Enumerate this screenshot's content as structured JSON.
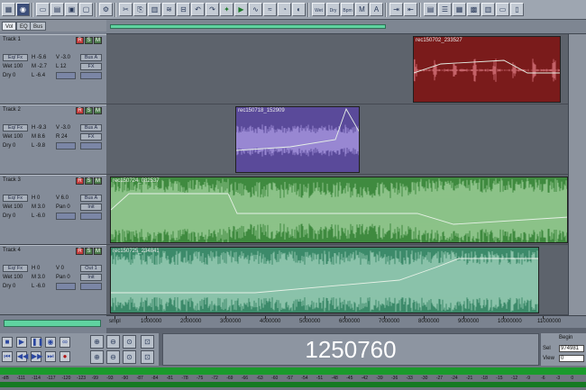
{
  "toolbar": {
    "buttons": [
      "grid",
      "cd",
      "",
      "new",
      "open",
      "save",
      "close",
      "",
      "prefs",
      "",
      "cut",
      "copy",
      "paste",
      "mix",
      "trim",
      "undo",
      "redo",
      "fx",
      "sel",
      "env",
      "wav",
      "vol",
      "pan",
      "",
      "wet",
      "fx1",
      "fx2",
      "fx3",
      "fx4",
      "",
      "split",
      "join",
      "",
      "clips",
      "list",
      "grid2",
      "grid3",
      "meter",
      "view1",
      "view2"
    ],
    "wet_label": "Wet",
    "dry_label": "Dry",
    "bpm_label": "Bpm"
  },
  "tabs": {
    "vol": "Vol",
    "eq": "EQ",
    "bus": "Bus"
  },
  "tracks": [
    {
      "name": "Track 1",
      "eq_label": "Eq/ Fx",
      "h": "H -5.6",
      "v": "V -3.0",
      "wet": "Wet 100",
      "m": "M -2.7",
      "l": "L 12",
      "dry": "Dry 0",
      "lo": "L -6.4",
      "bus": "Bus A",
      "fx": "FX",
      "clip": "rec150702_233527",
      "color": "#7a1b1b"
    },
    {
      "name": "Track 2",
      "eq_label": "Eq/ Fx",
      "h": "H -9.3",
      "v": "V -3.0",
      "wet": "Wet 100",
      "m": "M 8.6",
      "l": "R 24",
      "dry": "Dry 0",
      "lo": "L -9.8",
      "bus": "Bus A",
      "fx": "FX",
      "clip": "rec150718_152909",
      "color": "#5a4a9a"
    },
    {
      "name": "Track 3",
      "eq_label": "Eq/ Fx",
      "h": "H 0",
      "v": "V 6.0",
      "wet": "Wet 100",
      "m": "M 3.0",
      "l": "Pan 0",
      "dry": "Dry 0",
      "lo": "L -6.0",
      "bus": "Bus A",
      "fx": "Init",
      "clip": "rec150724_082537",
      "color": "#3f8a3f"
    },
    {
      "name": "Track 4",
      "eq_label": "Eq/ Fx",
      "h": "H 0",
      "v": "V 0",
      "wet": "Wet 100",
      "m": "M 3.0",
      "l": "Pan 0",
      "dry": "Dry 0",
      "lo": "L -6.0",
      "bus": "Out 1",
      "fx": "Init",
      "clip": "rec150725_234841",
      "color": "#3c8a6a"
    }
  ],
  "ruler": {
    "labels": [
      "smpl",
      "1000000",
      "2000000",
      "3000000",
      "4000000",
      "5000000",
      "6000000",
      "7000000",
      "8000000",
      "9000000",
      "10000000",
      "11000000"
    ]
  },
  "transport": {
    "time": "1250760",
    "begin_label": "Begin",
    "sel_label": "Sel",
    "sel_value": "974981",
    "view_label": "View",
    "view_value": "0"
  },
  "meter": {
    "labels": [
      "-dB",
      "-111",
      "-114",
      "-117",
      "-120",
      "-123",
      "-99",
      "-93",
      "-90",
      "-87",
      "-84",
      "-81",
      "-78",
      "-75",
      "-72",
      "-69",
      "-66",
      "-63",
      "-60",
      "-57",
      "-54",
      "-51",
      "-48",
      "-45",
      "-42",
      "-39",
      "-36",
      "-33",
      "-30",
      "-27",
      "-24",
      "-21",
      "-18",
      "-15",
      "-12",
      "-9",
      "-6",
      "-3",
      "0"
    ]
  }
}
